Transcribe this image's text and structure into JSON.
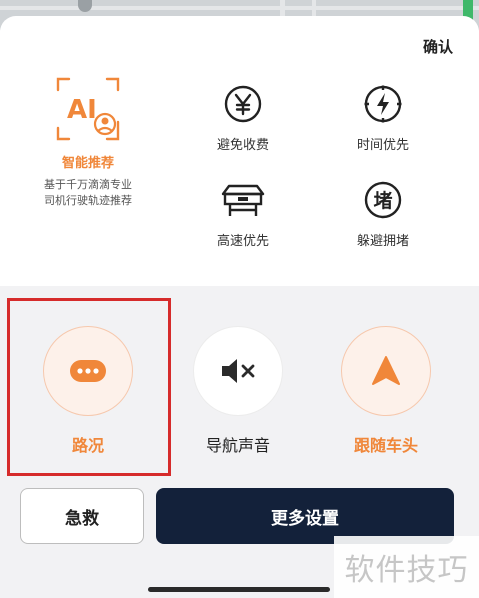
{
  "header": {
    "confirm_label": "确认"
  },
  "smart_recommend": {
    "title": "智能推荐",
    "desc_line1": "基于千万滴滴专业",
    "desc_line2": "司机行驶轨迹推荐",
    "icon": "ai-driver-icon"
  },
  "route_prefs": [
    {
      "label": "避免收费",
      "icon": "yuan-icon"
    },
    {
      "label": "时间优先",
      "icon": "compass-icon"
    },
    {
      "label": "高速优先",
      "icon": "highway-toll-icon"
    },
    {
      "label": "躲避拥堵",
      "icon": "congestion-icon",
      "glyph": "堵"
    }
  ],
  "quick_actions": [
    {
      "label": "路况",
      "icon": "traffic-dots-icon",
      "active": true
    },
    {
      "label": "导航声音",
      "icon": "speaker-mute-icon",
      "active": false
    },
    {
      "label": "跟随车头",
      "icon": "navigation-arrow-icon",
      "active": true
    }
  ],
  "buttons": {
    "rescue_label": "急救",
    "more_settings_label": "更多设置"
  },
  "watermark": "软件技巧",
  "colors": {
    "accent": "#f0873a",
    "dark_button": "#13213a",
    "highlight_border": "#d62b2b"
  }
}
